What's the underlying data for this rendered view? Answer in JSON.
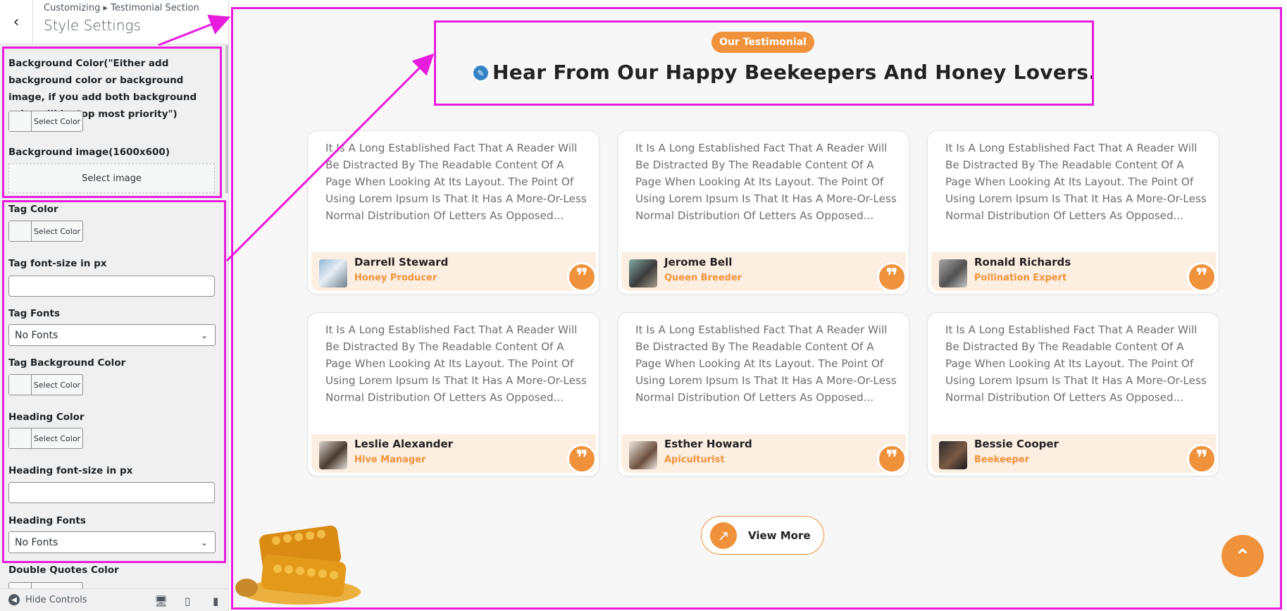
{
  "sidebar": {
    "breadcrumb": "Customizing ▸ Testimonial Section",
    "title": "Style Settings",
    "back_icon": "‹",
    "fields": {
      "bg_color_label": "Background Color(\"Either add background color or background image, if you add both background color will be top most priority\")",
      "bg_image_label": "Background image(1600x600)",
      "select_image": "Select image",
      "tag_color_label": "Tag Color",
      "tag_font_size_label": "Tag font-size in px",
      "tag_fonts_label": "Tag Fonts",
      "tag_fonts_value": "No Fonts",
      "tag_bg_color_label": "Tag Background Color",
      "heading_color_label": "Heading Color",
      "heading_font_size_label": "Heading font-size in px",
      "heading_fonts_label": "Heading Fonts",
      "heading_fonts_value": "No Fonts",
      "double_quotes_color_label": "Double Quotes Color",
      "select_color": "Select Color"
    },
    "footer": {
      "hide_controls": "Hide Controls"
    }
  },
  "section": {
    "tag": "Our Testimonial",
    "heading": "Hear From Our Happy Beekeepers And Honey Lovers.",
    "view_more": "View More",
    "testimonial_text": "It Is A Long Established Fact That A Reader Will Be Distracted By The Readable Content Of A Page When Looking At Its Layout. The Point Of Using Lorem Ipsum Is That It Has A More-Or-Less Normal Distribution Of Letters As Opposed...",
    "testimonials": [
      {
        "name": "Darrell Steward",
        "role": "Honey Producer"
      },
      {
        "name": "Jerome Bell",
        "role": "Queen Breeder"
      },
      {
        "name": "Ronald Richards",
        "role": "Pollination Expert"
      },
      {
        "name": "Leslie Alexander",
        "role": "Hive Manager"
      },
      {
        "name": "Esther Howard",
        "role": "Apiculturist"
      },
      {
        "name": "Bessie Cooper",
        "role": "Beekeeper"
      }
    ]
  },
  "colors": {
    "accent": "#f0923c",
    "highlight": "#e81cdd",
    "light_accent": "#fdeee2"
  }
}
